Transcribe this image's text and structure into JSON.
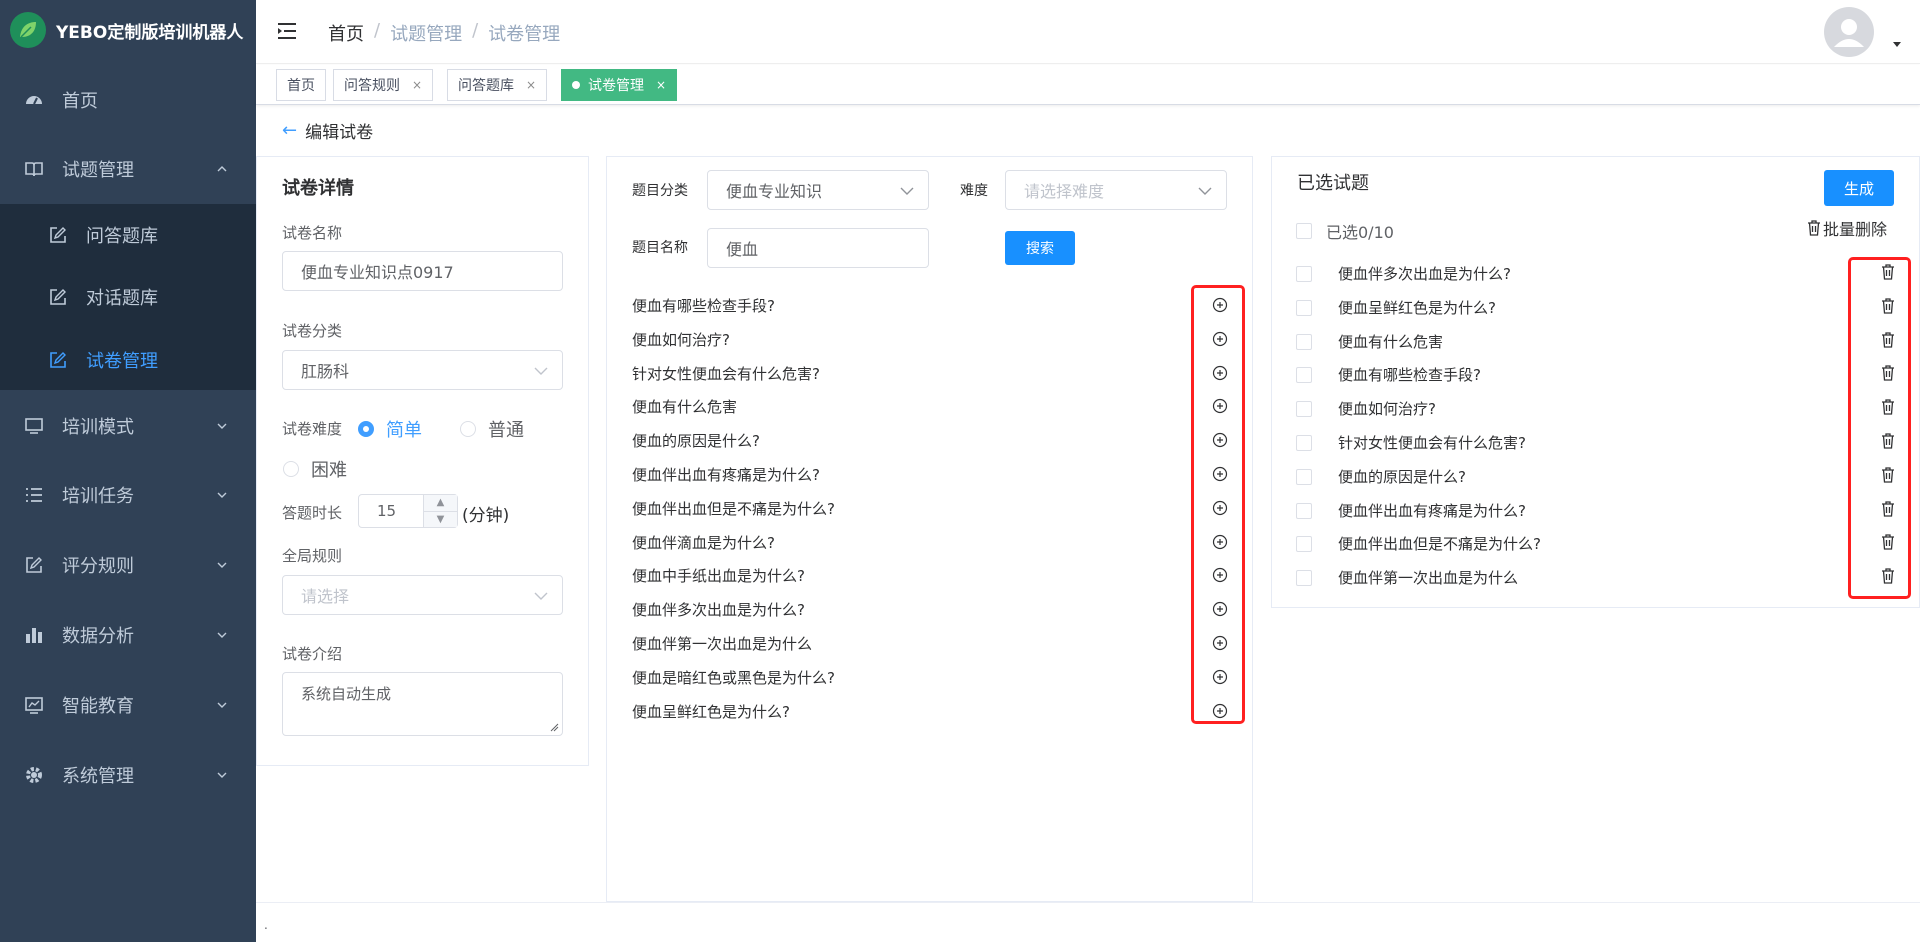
{
  "app": {
    "title": "YEBO定制版培训机器人"
  },
  "sidebar": {
    "items": [
      {
        "label": "首页",
        "icon": "dashboard-icon"
      },
      {
        "label": "试题管理",
        "icon": "book-icon"
      },
      {
        "label": "培训模式",
        "icon": "monitor-icon"
      },
      {
        "label": "培训任务",
        "icon": "list-icon"
      },
      {
        "label": "评分规则",
        "icon": "edit-icon"
      },
      {
        "label": "数据分析",
        "icon": "bar-chart-icon"
      },
      {
        "label": "智能教育",
        "icon": "chart-screen-icon"
      },
      {
        "label": "系统管理",
        "icon": "gear-icon"
      }
    ],
    "subitems": [
      {
        "label": "问答题库",
        "icon": "edit-icon"
      },
      {
        "label": "对话题库",
        "icon": "edit-icon"
      },
      {
        "label": "试卷管理",
        "icon": "edit-icon"
      }
    ]
  },
  "breadcrumb": [
    "首页",
    "试题管理",
    "试卷管理"
  ],
  "tabs": [
    {
      "label": "首页",
      "closable": false,
      "active": false
    },
    {
      "label": "问答规则",
      "closable": true,
      "active": false
    },
    {
      "label": "问答题库",
      "closable": true,
      "active": false
    },
    {
      "label": "试卷管理",
      "closable": true,
      "active": true
    }
  ],
  "page": {
    "back_label": "编辑试卷"
  },
  "details": {
    "title": "试卷详情",
    "name_label": "试卷名称",
    "name_value": "便血专业知识点0917",
    "category_label": "试卷分类",
    "category_value": "肛肠科",
    "difficulty_label": "试卷难度",
    "difficulty_options": [
      "简单",
      "普通",
      "困难"
    ],
    "difficulty_selected": "简单",
    "duration_label": "答题时长",
    "duration_value": "15",
    "duration_unit": "(分钟)",
    "rule_label": "全局规则",
    "rule_placeholder": "请选择",
    "intro_label": "试卷介绍",
    "intro_value": "系统自动生成"
  },
  "filter": {
    "category_label": "题目分类",
    "category_value": "便血专业知识",
    "difficulty_label": "难度",
    "difficulty_placeholder": "请选择难度",
    "name_label": "题目名称",
    "name_value": "便血",
    "search_button": "搜索"
  },
  "questions": [
    "便血有哪些检查手段?",
    "便血如何治疗?",
    "针对女性便血会有什么危害?",
    "便血有什么危害",
    "便血的原因是什么?",
    "便血伴出血有疼痛是为什么?",
    "便血伴出血但是不痛是为什么?",
    "便血伴滴血是为什么?",
    "便血中手纸出血是为什么?",
    "便血伴多次出血是为什么?",
    "便血伴第一次出血是为什么",
    "便血是暗红色或黑色是为什么?",
    "便血呈鲜红色是为什么?"
  ],
  "selected": {
    "title": "已选试题",
    "generate_button": "生成",
    "count_label": "已选0/10",
    "batch_delete": "批量删除",
    "items": [
      "便血伴多次出血是为什么?",
      "便血呈鲜红色是为什么?",
      "便血有什么危害",
      "便血有哪些检查手段?",
      "便血如何治疗?",
      "针对女性便血会有什么危害?",
      "便血的原因是什么?",
      "便血伴出血有疼痛是为什么?",
      "便血伴出血但是不痛是为什么?",
      "便血伴第一次出血是为什么"
    ]
  },
  "colors": {
    "sidebar": "#304156",
    "primary": "#1890ff",
    "active_tab": "#42b983",
    "highlight": "#ff2020"
  }
}
